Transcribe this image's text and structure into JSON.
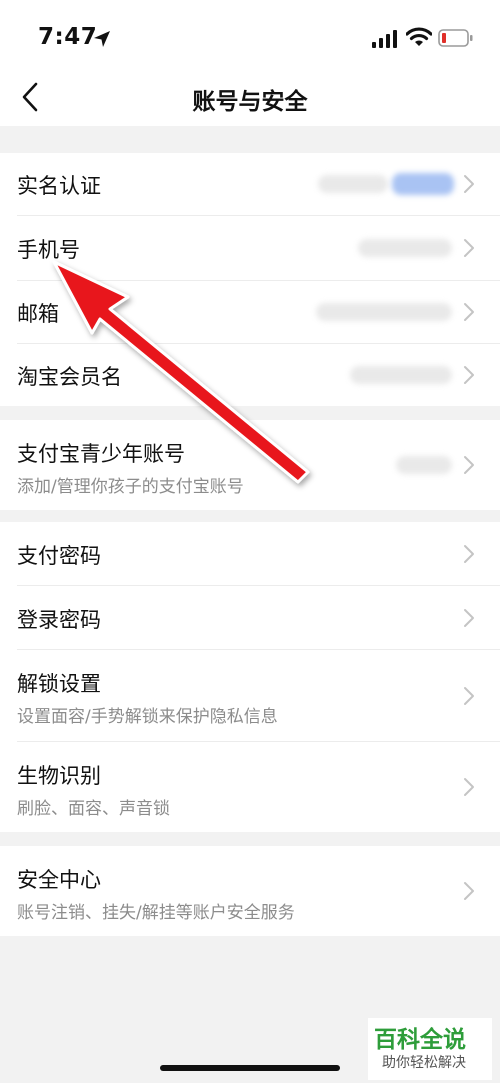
{
  "status": {
    "time": "7:47"
  },
  "header": {
    "title": "账号与安全"
  },
  "groups": [
    {
      "items": [
        {
          "label": "实名认证"
        },
        {
          "label": "手机号"
        },
        {
          "label": "邮箱"
        },
        {
          "label": "淘宝会员名"
        }
      ]
    },
    {
      "items": [
        {
          "label": "支付宝青少年账号",
          "sub": "添加/管理你孩子的支付宝账号"
        }
      ]
    },
    {
      "items": [
        {
          "label": "支付密码"
        },
        {
          "label": "登录密码"
        },
        {
          "label": "解锁设置",
          "sub": "设置面容/手势解锁来保护隐私信息"
        },
        {
          "label": "生物识别",
          "sub": "刷脸、面容、声音锁"
        }
      ]
    },
    {
      "items": [
        {
          "label": "安全中心",
          "sub": "账号注销、挂失/解挂等账户安全服务"
        }
      ]
    }
  ],
  "watermark": {
    "title": "百科全说",
    "subtitle": "助你轻松解决"
  },
  "colors": {
    "arrow": "#e8181b",
    "watermark": "#2e9d3a",
    "background": "#f2f2f2"
  },
  "icons": [
    "location-arrow-icon",
    "cellular-signal-icon",
    "wifi-icon",
    "battery-low-icon",
    "back-chevron-icon",
    "chevron-right-icon"
  ]
}
